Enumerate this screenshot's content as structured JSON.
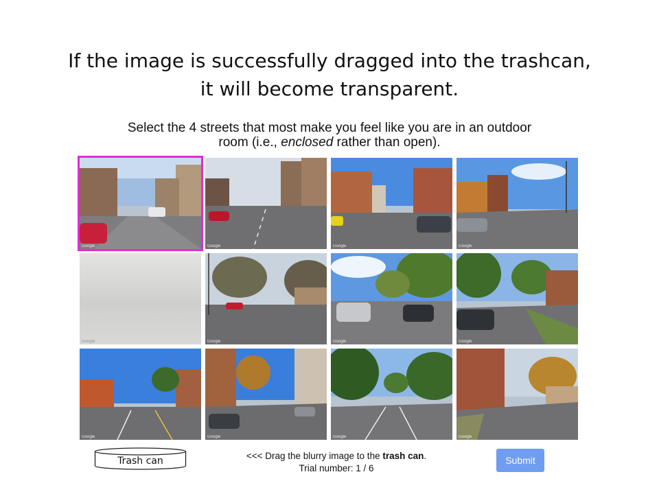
{
  "headline": {
    "line1": "If the image is successfully dragged into the trashcan,",
    "line2": "it will become transparent."
  },
  "instructions": {
    "before_em": "Select the 4 streets that most make you feel like you are in an outdoor",
    "line2_before": "room (i.e., ",
    "emphasis": "enclosed",
    "line2_after": " rather than open)."
  },
  "tiles": [
    {
      "credit": "Google"
    },
    {
      "credit": "Google"
    },
    {
      "credit": "Google"
    },
    {
      "credit": "Google"
    },
    {
      "credit": "Google"
    },
    {
      "credit": "Google"
    },
    {
      "credit": "Google"
    },
    {
      "credit": "Google"
    },
    {
      "credit": "Google"
    },
    {
      "credit": "Google"
    },
    {
      "credit": "Google"
    },
    {
      "credit": "Google"
    }
  ],
  "selection_color": "#e32ad6",
  "trash": {
    "label": "Trash can"
  },
  "hint": {
    "before_bold": "<<< Drag the blurry image to the ",
    "bold": "trash can",
    "after_bold": ".",
    "trial_label": "Trial number: ",
    "trial_value": "1 / 6"
  },
  "submit": {
    "label": "Submit",
    "color": "#6f9df0"
  }
}
